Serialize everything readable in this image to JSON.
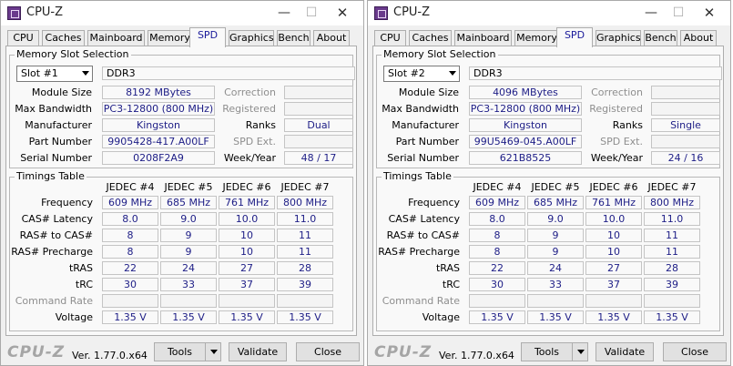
{
  "windows": [
    {
      "title": "CPU-Z",
      "tabs": [
        "CPU",
        "Caches",
        "Mainboard",
        "Memory",
        "SPD",
        "Graphics",
        "Bench",
        "About"
      ],
      "active_tab": "SPD",
      "memory_slot": {
        "group_label": "Memory Slot Selection",
        "slot": "Slot #1",
        "type": "DDR3",
        "module_size": "8192 MBytes",
        "max_bandwidth": "PC3-12800 (800 MHz)",
        "manufacturer": "Kingston",
        "part_number": "9905428-417.A00LF",
        "serial_number": "0208F2A9",
        "correction": "",
        "registered": "",
        "ranks": "Dual",
        "spd_ext": "",
        "week_year": "48 / 17"
      },
      "timings": {
        "group_label": "Timings Table",
        "columns": [
          "JEDEC #4",
          "JEDEC #5",
          "JEDEC #6",
          "JEDEC #7"
        ],
        "rows": [
          {
            "label": "Frequency",
            "values": [
              "609 MHz",
              "685 MHz",
              "761 MHz",
              "800 MHz"
            ]
          },
          {
            "label": "CAS# Latency",
            "values": [
              "8.0",
              "9.0",
              "10.0",
              "11.0"
            ]
          },
          {
            "label": "RAS# to CAS#",
            "values": [
              "8",
              "9",
              "10",
              "11"
            ]
          },
          {
            "label": "RAS# Precharge",
            "values": [
              "8",
              "9",
              "10",
              "11"
            ]
          },
          {
            "label": "tRAS",
            "values": [
              "22",
              "24",
              "27",
              "28"
            ]
          },
          {
            "label": "tRC",
            "values": [
              "30",
              "33",
              "37",
              "39"
            ]
          },
          {
            "label": "Command Rate",
            "values": [
              "",
              "",
              "",
              ""
            ]
          },
          {
            "label": "Voltage",
            "values": [
              "1.35 V",
              "1.35 V",
              "1.35 V",
              "1.35 V"
            ]
          }
        ]
      },
      "footer": {
        "brand": "CPU-Z",
        "version": "Ver. 1.77.0.x64",
        "tools": "Tools",
        "validate": "Validate",
        "close": "Close"
      }
    },
    {
      "title": "CPU-Z",
      "tabs": [
        "CPU",
        "Caches",
        "Mainboard",
        "Memory",
        "SPD",
        "Graphics",
        "Bench",
        "About"
      ],
      "active_tab": "SPD",
      "memory_slot": {
        "group_label": "Memory Slot Selection",
        "slot": "Slot #2",
        "type": "DDR3",
        "module_size": "4096 MBytes",
        "max_bandwidth": "PC3-12800 (800 MHz)",
        "manufacturer": "Kingston",
        "part_number": "99U5469-045.A00LF",
        "serial_number": "621B8525",
        "correction": "",
        "registered": "",
        "ranks": "Single",
        "spd_ext": "",
        "week_year": "24 / 16"
      },
      "timings": {
        "group_label": "Timings Table",
        "columns": [
          "JEDEC #4",
          "JEDEC #5",
          "JEDEC #6",
          "JEDEC #7"
        ],
        "rows": [
          {
            "label": "Frequency",
            "values": [
              "609 MHz",
              "685 MHz",
              "761 MHz",
              "800 MHz"
            ]
          },
          {
            "label": "CAS# Latency",
            "values": [
              "8.0",
              "9.0",
              "10.0",
              "11.0"
            ]
          },
          {
            "label": "RAS# to CAS#",
            "values": [
              "8",
              "9",
              "10",
              "11"
            ]
          },
          {
            "label": "RAS# Precharge",
            "values": [
              "8",
              "9",
              "10",
              "11"
            ]
          },
          {
            "label": "tRAS",
            "values": [
              "22",
              "24",
              "27",
              "28"
            ]
          },
          {
            "label": "tRC",
            "values": [
              "30",
              "33",
              "37",
              "39"
            ]
          },
          {
            "label": "Command Rate",
            "values": [
              "",
              "",
              "",
              ""
            ]
          },
          {
            "label": "Voltage",
            "values": [
              "1.35 V",
              "1.35 V",
              "1.35 V",
              "1.35 V"
            ]
          }
        ]
      },
      "footer": {
        "brand": "CPU-Z",
        "version": "Ver. 1.77.0.x64",
        "tools": "Tools",
        "validate": "Validate",
        "close": "Close"
      }
    }
  ],
  "labels": {
    "module_size": "Module Size",
    "max_bandwidth": "Max Bandwidth",
    "manufacturer": "Manufacturer",
    "part_number": "Part Number",
    "serial_number": "Serial Number",
    "correction": "Correction",
    "registered": "Registered",
    "ranks": "Ranks",
    "spd_ext": "SPD Ext.",
    "week_year": "Week/Year"
  },
  "window_controls": {
    "minimize": "—",
    "maximize": "☐",
    "close": "✕"
  },
  "colors": {
    "value_text": "#1d1d86",
    "dim_label": "#8e8e8e",
    "window_bg": "#f0f0f0",
    "panel_bg": "#f9f9f9"
  },
  "icons": [
    "cpu-z-app-icon",
    "dropdown-arrow-icon",
    "minimize-icon",
    "maximize-icon",
    "close-icon"
  ]
}
